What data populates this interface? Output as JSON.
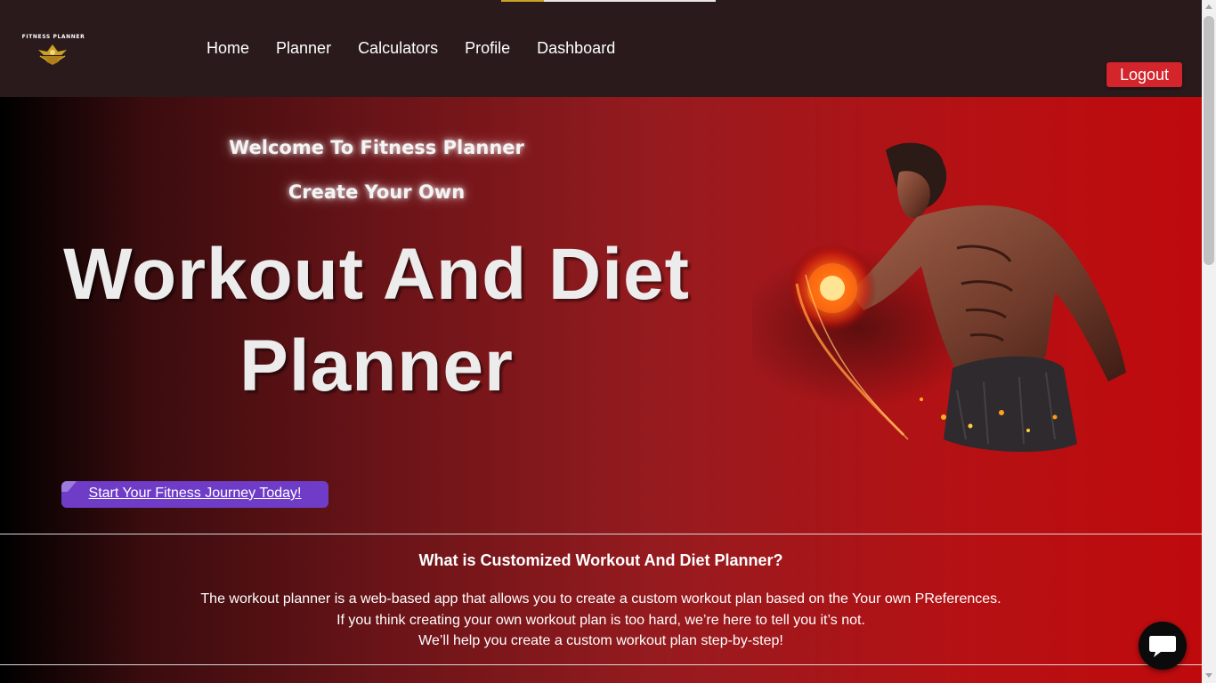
{
  "brand": {
    "name": "FITNESS PLANNER",
    "logo_icon": "crown-emblem-icon",
    "accent": "#c9a227"
  },
  "nav": {
    "links": [
      "Home",
      "Planner",
      "Calculators",
      "Profile",
      "Dashboard"
    ],
    "logout_label": "Logout"
  },
  "hero": {
    "welcome": "Welcome To Fitness Planner",
    "subtitle": "Create Your Own",
    "title_line1": "Workout And Diet",
    "title_line2": "Planner",
    "cta_label": "Start Your Fitness Journey Today!",
    "image": "muscular-man-with-flaming-dumbbell-image"
  },
  "about": {
    "heading": "What is Customized Workout And Diet Planner?",
    "lines": [
      "The workout planner is a web-based app that allows you to create a custom workout plan based on the Your own PReferences.",
      "If you think creating your own workout plan is too hard, we’re here to tell you it’s not.",
      "We’ll help you create a custom workout plan step-by-step!"
    ]
  },
  "chat": {
    "icon": "chat-bubble-icon"
  },
  "colors": {
    "navbar_bg": "#2a1a1b",
    "logout_bg": "#d3252b",
    "cta_bg": "#6f3cc8",
    "hero_gradient_start": "#000000",
    "hero_gradient_end": "#bf0a0d"
  }
}
